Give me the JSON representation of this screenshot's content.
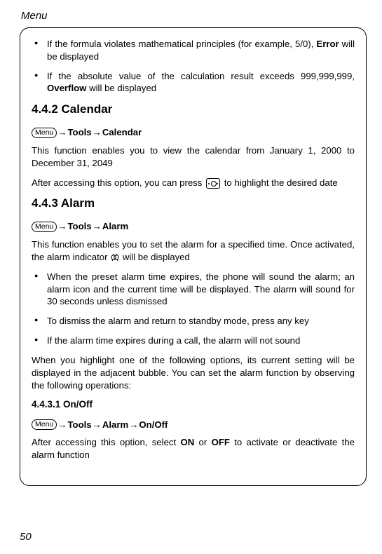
{
  "header": "Menu",
  "pageNumber": "50",
  "menuBadge": "Menu",
  "arrow": "→",
  "bullets1": [
    {
      "pre": "If the formula violates mathematical principles (for example, 5/0), ",
      "bold": "Error",
      "post": " will be displayed"
    },
    {
      "pre": "If the absolute value of the calculation result exceeds 999,999,999, ",
      "bold": "Overflow",
      "post": " will be displayed"
    }
  ],
  "sec442": {
    "title": "4.4.2 Calendar",
    "crumb": [
      "Tools",
      "Calendar"
    ],
    "p1": "This function enables you to view the calendar from January 1, 2000 to December 31, 2049",
    "p2a": "After accessing this option, you can press ",
    "p2b": " to highlight the desired date"
  },
  "sec443": {
    "title": "4.4.3 Alarm",
    "crumb": [
      "Tools",
      "Alarm"
    ],
    "p1a": "This function enables you to set the alarm for a specified time. Once activated, the alarm indicator ",
    "p1b": " will be displayed",
    "bullets": [
      "When the preset alarm time expires, the phone will sound the alarm; an alarm icon and the current time will be displayed. The alarm will sound for 30 seconds unless dismissed",
      "To dismiss the alarm and return to standby mode, press any key",
      "If the alarm time expires during a call, the alarm will not sound"
    ],
    "p2": "When you highlight one of the following options, its current setting will be displayed in the adjacent bubble. You can set the alarm function by observing the following operations:"
  },
  "sec4431": {
    "title": "4.4.3.1 On/Off",
    "crumb": [
      "Tools",
      "Alarm",
      "On/Off"
    ],
    "p_a": "After accessing this option, select ",
    "on": "ON",
    "or": " or ",
    "off": "OFF",
    "p_b": " to activate or deactivate the alarm function"
  }
}
